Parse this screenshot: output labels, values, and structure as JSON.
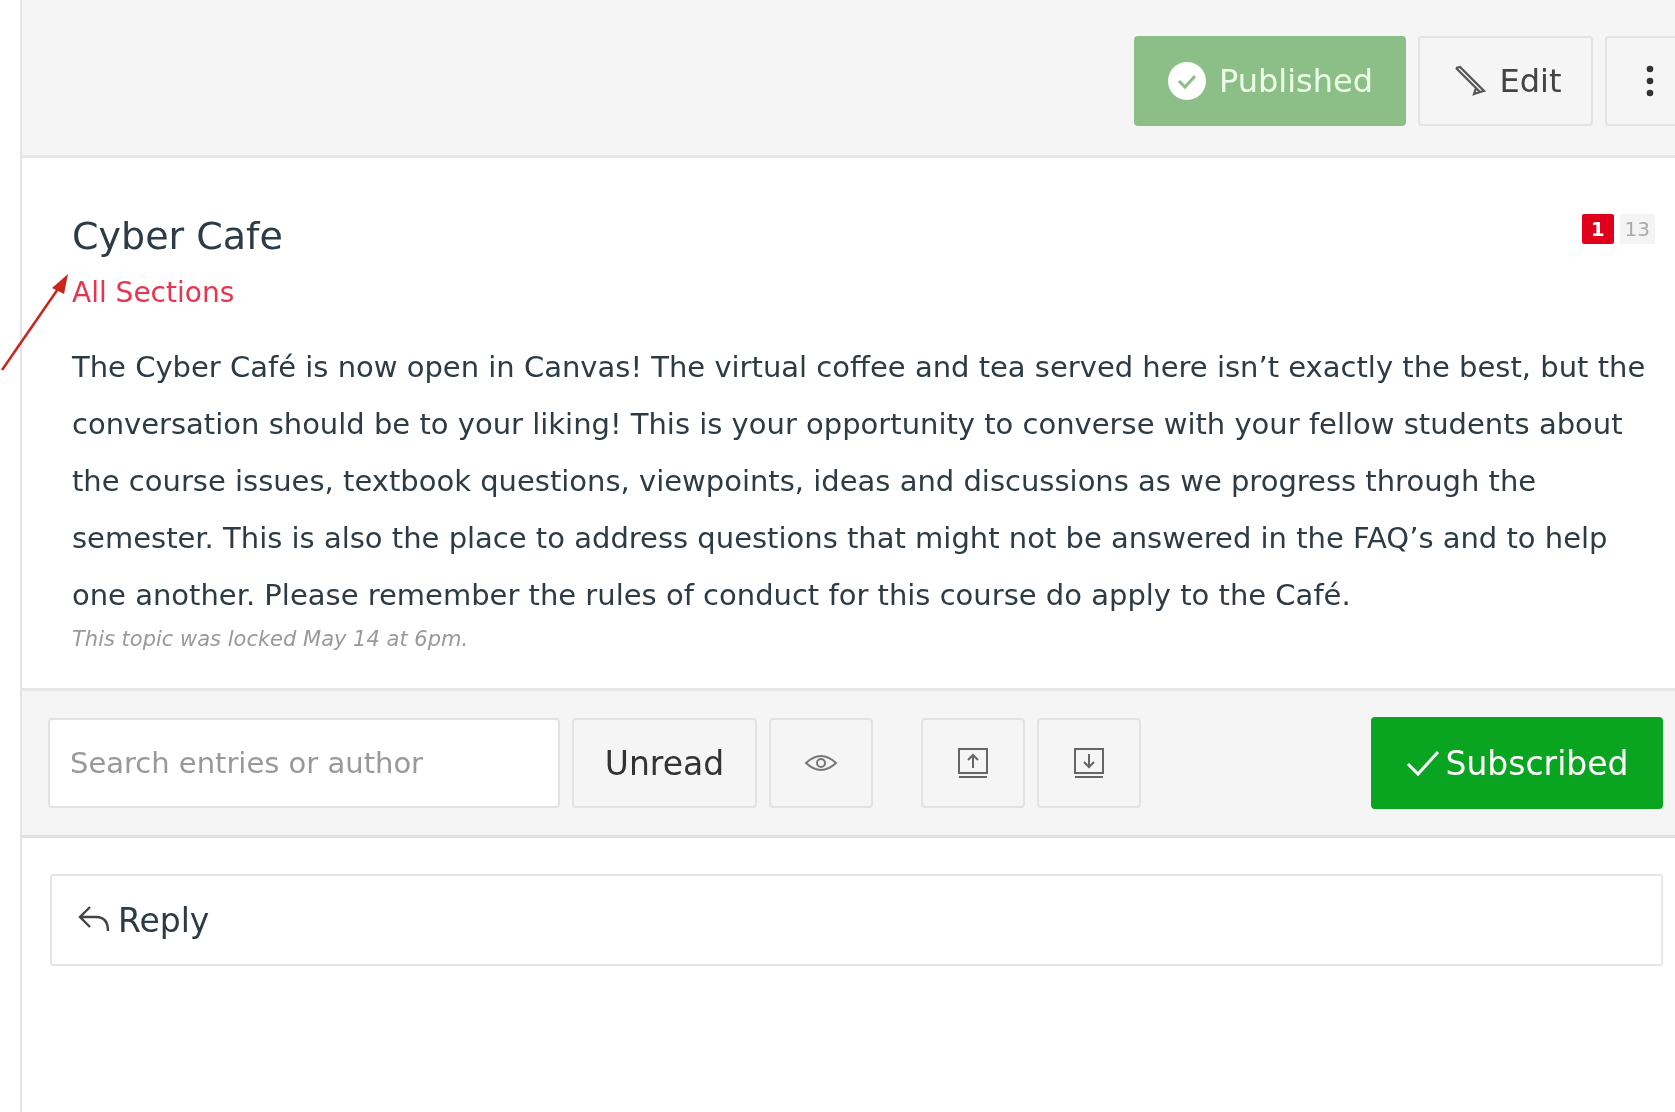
{
  "header": {
    "published": true,
    "publish_label": "Published",
    "edit_label": "Edit"
  },
  "topic": {
    "title": "Cyber Cafe",
    "unread_count": "1",
    "total_count": "13",
    "sections": "All Sections",
    "message": "The Cyber Café is now open in Canvas! The virtual coffee and tea served here isn’t exactly the best, but the conversation should be to your liking!  This is your opportunity to converse with your fellow students about the course issues, textbook questions, viewpoints, ideas and discussions as we progress through the semester.  This is also the place to address questions that might not be answered in the FAQ’s and to help one another.  Please remember the rules of conduct for this course do apply to the Café.",
    "lock_note": "This topic was locked May 14 at 6pm."
  },
  "toolbar": {
    "search": {
      "placeholder": "Search entries or author"
    },
    "filter_label": "Unread",
    "subscribed": true,
    "subscribe_label": "Subscribed"
  },
  "reply": {
    "label": "Reply"
  }
}
